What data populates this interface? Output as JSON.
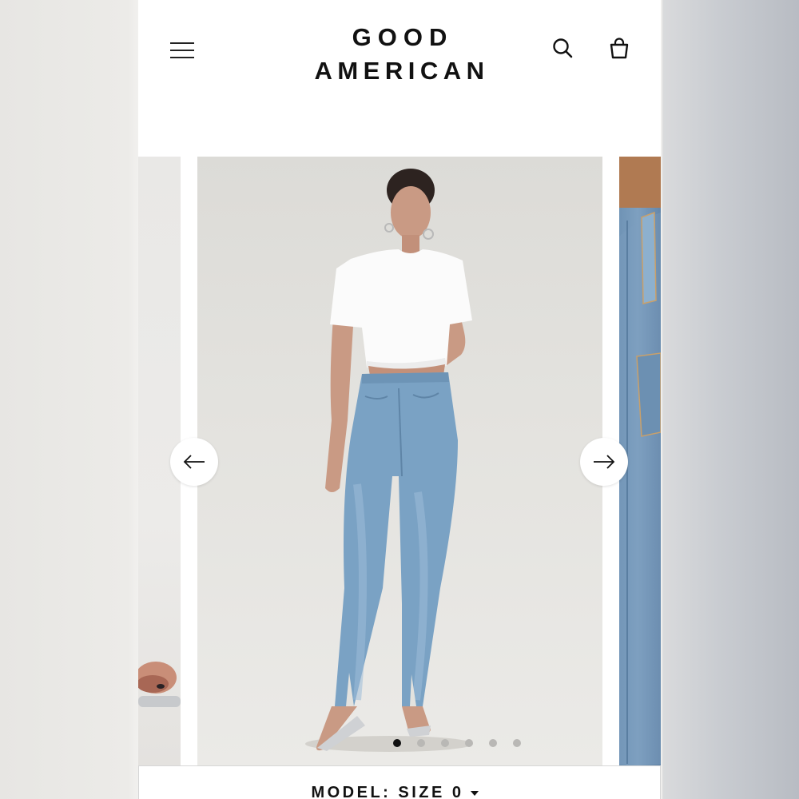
{
  "header": {
    "logo_line1": "GOOD",
    "logo_line2": "AMERICAN",
    "icons": {
      "menu": "hamburger-menu-icon",
      "search": "search-icon",
      "bag": "shopping-bag-icon"
    }
  },
  "gallery": {
    "images": [
      {
        "content": "previous product image (sandal detail)"
      },
      {
        "content": "model wearing white crop tee and high-rise light blue straight jeans with front hem slits"
      },
      {
        "content": "next product image (denim pocket close-up)"
      }
    ],
    "dot_count": 6,
    "active_index": 0,
    "icons": {
      "prev": "arrow-left-icon",
      "next": "arrow-right-icon"
    }
  },
  "size_selector": {
    "label": "MODEL: SIZE 0",
    "icon": "caret-down-icon"
  },
  "colors": {
    "text": "#111111",
    "denim": "#7aa2c4",
    "background": "#ffffff"
  }
}
